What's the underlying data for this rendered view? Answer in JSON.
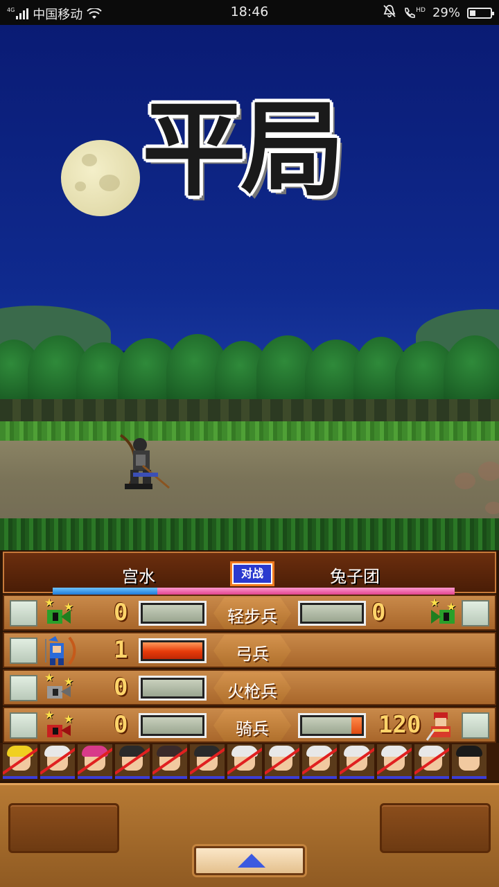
{
  "status_bar": {
    "network_badge": "4G",
    "carrier": "中国移动",
    "time": "18:46",
    "battery": "29%",
    "battery_level": 0.29,
    "hd_label": "HD"
  },
  "result": {
    "text": "平局"
  },
  "battle": {
    "team_left": "宫水",
    "team_right": "兔子团",
    "vs_label": "对战",
    "left_hp_fraction": 0.26,
    "colors": {
      "left": "#1e7ad8",
      "right": "#e0458f"
    },
    "rows": [
      {
        "label": "轻步兵",
        "left_count": "0",
        "left_gauge": 0,
        "right_count": "0",
        "right_gauge": 0,
        "has_right": true
      },
      {
        "label": "弓兵",
        "left_count": "1",
        "left_gauge": 1.0,
        "has_right": false
      },
      {
        "label": "火枪兵",
        "left_count": "0",
        "left_gauge": 0,
        "has_right": false
      },
      {
        "label": "骑兵",
        "left_count": "0",
        "left_gauge": 0,
        "right_count": "120",
        "right_gauge": 0.18,
        "has_right": true
      }
    ]
  },
  "portraits_count": 13,
  "controls": {
    "up_icon": "up-triangle-icon"
  }
}
